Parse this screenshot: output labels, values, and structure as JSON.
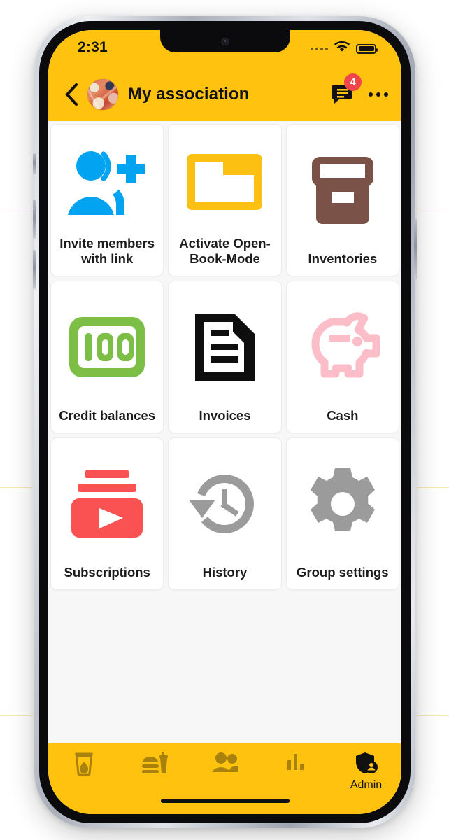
{
  "status_bar": {
    "time": "2:31",
    "signal_icon": "signal-dots-icon",
    "wifi_icon": "wifi-icon",
    "battery_icon": "battery-full-icon"
  },
  "header": {
    "back_icon": "chevron-left-icon",
    "avatar_name": "group-avatar",
    "title": "My association",
    "chat_icon": "chat-bubble-icon",
    "chat_badge": "4",
    "more_icon": "more-horizontal-icon"
  },
  "colors": {
    "brand_yellow": "#FFC20E",
    "badge_red": "#F0464B",
    "tile_blue": "#02A3F0",
    "tile_yellow": "#FCC013",
    "tile_brown": "#7A5248",
    "tile_green": "#7DBE46",
    "tile_black": "#0E0E0E",
    "tile_pink": "#FBBDC8",
    "tile_red": "#FA5252",
    "tile_gray": "#9B9B9B",
    "nav_inactive": "#A8820C",
    "nav_active": "#111111",
    "screen_bg": "#F7F7F7",
    "card_bg": "#FFFFFF"
  },
  "tiles": [
    {
      "label": "Invite members with link",
      "icon": "person-add-icon",
      "color": "#02A3F0"
    },
    {
      "label": "Activate Open-Book-Mode",
      "icon": "folder-icon",
      "color": "#FCC013"
    },
    {
      "label": "Inventories",
      "icon": "archive-box-icon",
      "color": "#7A5248"
    },
    {
      "label": "Credit balances",
      "icon": "hundred-points-icon",
      "color": "#7DBE46"
    },
    {
      "label": "Invoices",
      "icon": "document-icon",
      "color": "#0E0E0E"
    },
    {
      "label": "Cash",
      "icon": "piggy-bank-icon",
      "color": "#FBBDC8"
    },
    {
      "label": "Subscriptions",
      "icon": "subscriptions-play-icon",
      "color": "#FA5252"
    },
    {
      "label": "History",
      "icon": "history-clock-icon",
      "color": "#9B9B9B"
    },
    {
      "label": "Group settings",
      "icon": "gear-icon",
      "color": "#9B9B9B"
    }
  ],
  "bottom_nav": {
    "items": [
      {
        "label": "",
        "icon": "drink-glass-icon",
        "active": false
      },
      {
        "label": "",
        "icon": "food-burger-drink-icon",
        "active": false
      },
      {
        "label": "",
        "icon": "people-icon",
        "active": false
      },
      {
        "label": "",
        "icon": "bar-chart-icon",
        "active": false
      },
      {
        "label": "Admin",
        "icon": "shield-person-icon",
        "active": true
      }
    ]
  }
}
